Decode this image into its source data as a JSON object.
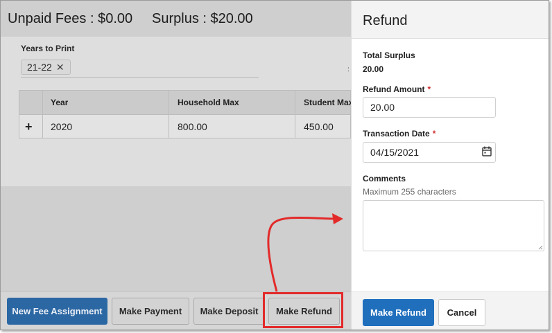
{
  "summary": {
    "unpaid_fees": "Unpaid Fees : $0.00",
    "surplus": "Surplus : $20.00"
  },
  "years_to_print": {
    "label": "Years to Print",
    "chips": [
      "21-22"
    ],
    "remove_glyph": "✕",
    "stray": ":"
  },
  "grid": {
    "expand_glyph": "+",
    "columns": [
      "Year",
      "Household Max",
      "Student Max"
    ],
    "rows": [
      {
        "year": "2020",
        "household_max": "800.00",
        "student_max": "450.00"
      }
    ]
  },
  "footer": {
    "new_fee_assignment": "New Fee Assignment",
    "make_payment": "Make Payment",
    "make_deposit": "Make Deposit",
    "make_refund": "Make Refund"
  },
  "refund_panel": {
    "title": "Refund",
    "total_surplus_label": "Total Surplus",
    "total_surplus_value": "20.00",
    "refund_amount_label": "Refund Amount",
    "refund_amount_value": "20.00",
    "transaction_date_label": "Transaction Date",
    "transaction_date_value": "04/15/2021",
    "required_mark": "*",
    "comments_label": "Comments",
    "comments_hint": "Maximum 255 characters",
    "comments_value": "",
    "submit_label": "Make Refund",
    "cancel_label": "Cancel"
  },
  "icons": {
    "calendar": "calendar-icon",
    "remove_chip": "close-icon",
    "expand_row": "plus-icon",
    "annotation_arrow": "arrow-icon"
  },
  "colors": {
    "primary_blue": "#1f6fbd",
    "dimmed_blue": "#2b67a3",
    "annotation_red": "#e32a2a",
    "required_red": "#d12b2b"
  }
}
